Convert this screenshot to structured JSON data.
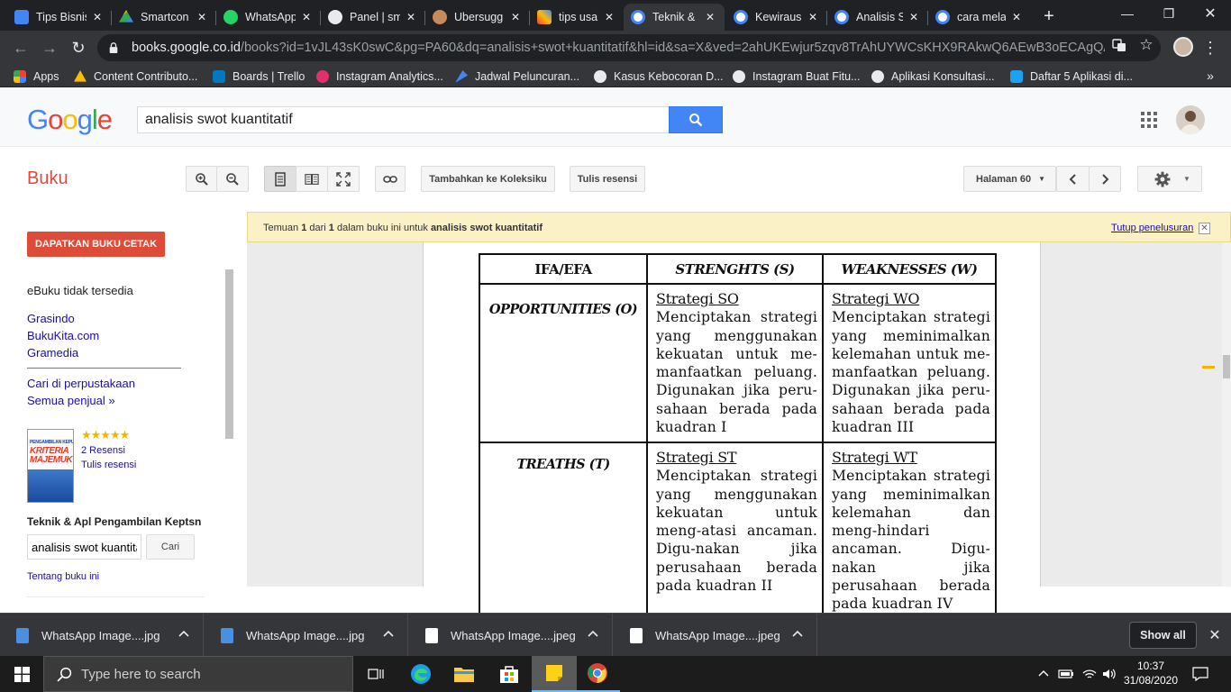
{
  "browser": {
    "tabs": [
      {
        "title": "Tips Bisnis",
        "favicon_color": "#4285f4",
        "active": false
      },
      {
        "title": "Smartcon",
        "favicon_color": "#34a853",
        "active": false
      },
      {
        "title": "WhatsApp",
        "favicon_color": "#25d366",
        "active": false
      },
      {
        "title": "Panel | sm",
        "favicon_color": "#e8eaed",
        "active": false
      },
      {
        "title": "Ubersugg",
        "favicon_color": "#c68a5b",
        "active": false
      },
      {
        "title": "tips usah",
        "favicon_color": "#4285f4",
        "active": false
      },
      {
        "title": "Teknik & ",
        "favicon_color": "#ffffff",
        "active": true
      },
      {
        "title": "Kewiraus",
        "favicon_color": "#ffffff",
        "active": false
      },
      {
        "title": "Analisis S",
        "favicon_color": "#ffffff",
        "active": false
      },
      {
        "title": "cara mela",
        "favicon_color": "#ffffff",
        "active": false
      }
    ],
    "url_host": "books.google.co.id",
    "url_rest": "/books?id=1vJL43sK0swC&pg=PA60&dq=analisis+swot+kuantitatif&hl=id&sa=X&ved=2ahUKEwjur5zqv8TrAhUYWCsKHX9RAkwQ6AEwB3oECAgQAg#v...",
    "bookmarks": [
      {
        "label": "Apps",
        "color": "#ea4335"
      },
      {
        "label": "Content Contributo...",
        "color": "#fbbc05"
      },
      {
        "label": "Boards | Trello",
        "color": "#0079bf"
      },
      {
        "label": "Instagram Analytics...",
        "color": "#e1306c"
      },
      {
        "label": "Jadwal Peluncuran...",
        "color": "#4285f4"
      },
      {
        "label": "Kasus Kebocoran D...",
        "color": "#e8eaed"
      },
      {
        "label": "Instagram Buat Fitu...",
        "color": "#e8eaed"
      },
      {
        "label": "Aplikasi Konsultasi...",
        "color": "#e8eaed"
      },
      {
        "label": "Daftar 5 Aplikasi di...",
        "color": "#1da1f2"
      }
    ]
  },
  "google": {
    "logo": "Google",
    "query": "analisis swot kuantitatif"
  },
  "books": {
    "label": "Buku",
    "add_collection": "Tambahkan ke Koleksiku",
    "write_review": "Tulis resensi",
    "page_selector": "Halaman 60"
  },
  "left": {
    "buy_button": "DAPATKAN BUKU CETAK",
    "ebook_status": "eBuku tidak tersedia",
    "sellers": [
      "Grasindo",
      "BukuKita.com",
      "Gramedia"
    ],
    "library_link": "Cari di perpustakaan",
    "all_sellers_link": "Semua penjual »",
    "reviews_count": "2 Resensi",
    "write_review_link": "Tulis resensi",
    "rating_stars": "★★★★★",
    "cover_title": "KRITERIA MAJEMUK",
    "cover_top": "PENGAMBILAN KEPUTUSAN",
    "book_title": "Teknik & Apl Pengambilan Keptsn",
    "search_in_book": "analisis swot kuantitatif",
    "search_button": "Cari",
    "about_link": "Tentang buku ini"
  },
  "notice": {
    "prefix": "Temuan ",
    "n1": "1",
    "middle": " dari ",
    "n2": "1",
    "suffix": " dalam buku ini untuk ",
    "term": "analisis swot kuantitatif",
    "close_link": "Tutup penelusuran"
  },
  "swot_table": {
    "headers": [
      "IFA/EFA",
      "STRENGHTS (S)",
      "WEAKNESSES (W)"
    ],
    "rows": [
      {
        "label": "OPPORTUNITIES (O)",
        "cells": [
          {
            "name": "Strategi SO",
            "desc": "Menciptakan strategi yang menggunakan kekuatan untuk me-manfaatkan peluang. Digunakan jika peru-sahaan berada pada kuadran I"
          },
          {
            "name": "Strategi WO",
            "desc": "Menciptakan strategi yang meminimalkan kelemahan untuk me-manfaatkan peluang. Digunakan jika peru-sahaan berada pada kuadran III"
          }
        ]
      },
      {
        "label": "TREATHS (T)",
        "cells": [
          {
            "name": "Strategi ST",
            "desc": "Menciptakan strategi yang menggunakan kekuatan untuk meng-atasi ancaman. Digu-nakan jika perusahaan berada pada kuadran II"
          },
          {
            "name": "Strategi WT",
            "desc": "Menciptakan strategi yang meminimalkan kelemahan dan meng-hindari ancaman. Digu-nakan jika perusahaan berada pada kuadran IV"
          }
        ]
      }
    ]
  },
  "downloads": {
    "items": [
      {
        "name": "WhatsApp Image....jpg",
        "color": "#4a90e2"
      },
      {
        "name": "WhatsApp Image....jpg",
        "color": "#4a90e2"
      },
      {
        "name": "WhatsApp Image....jpeg",
        "color": "#ffffff"
      },
      {
        "name": "WhatsApp Image....jpeg",
        "color": "#ffffff"
      }
    ],
    "show_all": "Show all"
  },
  "taskbar": {
    "search_placeholder": "Type here to search",
    "time": "10:37",
    "date": "31/08/2020"
  }
}
